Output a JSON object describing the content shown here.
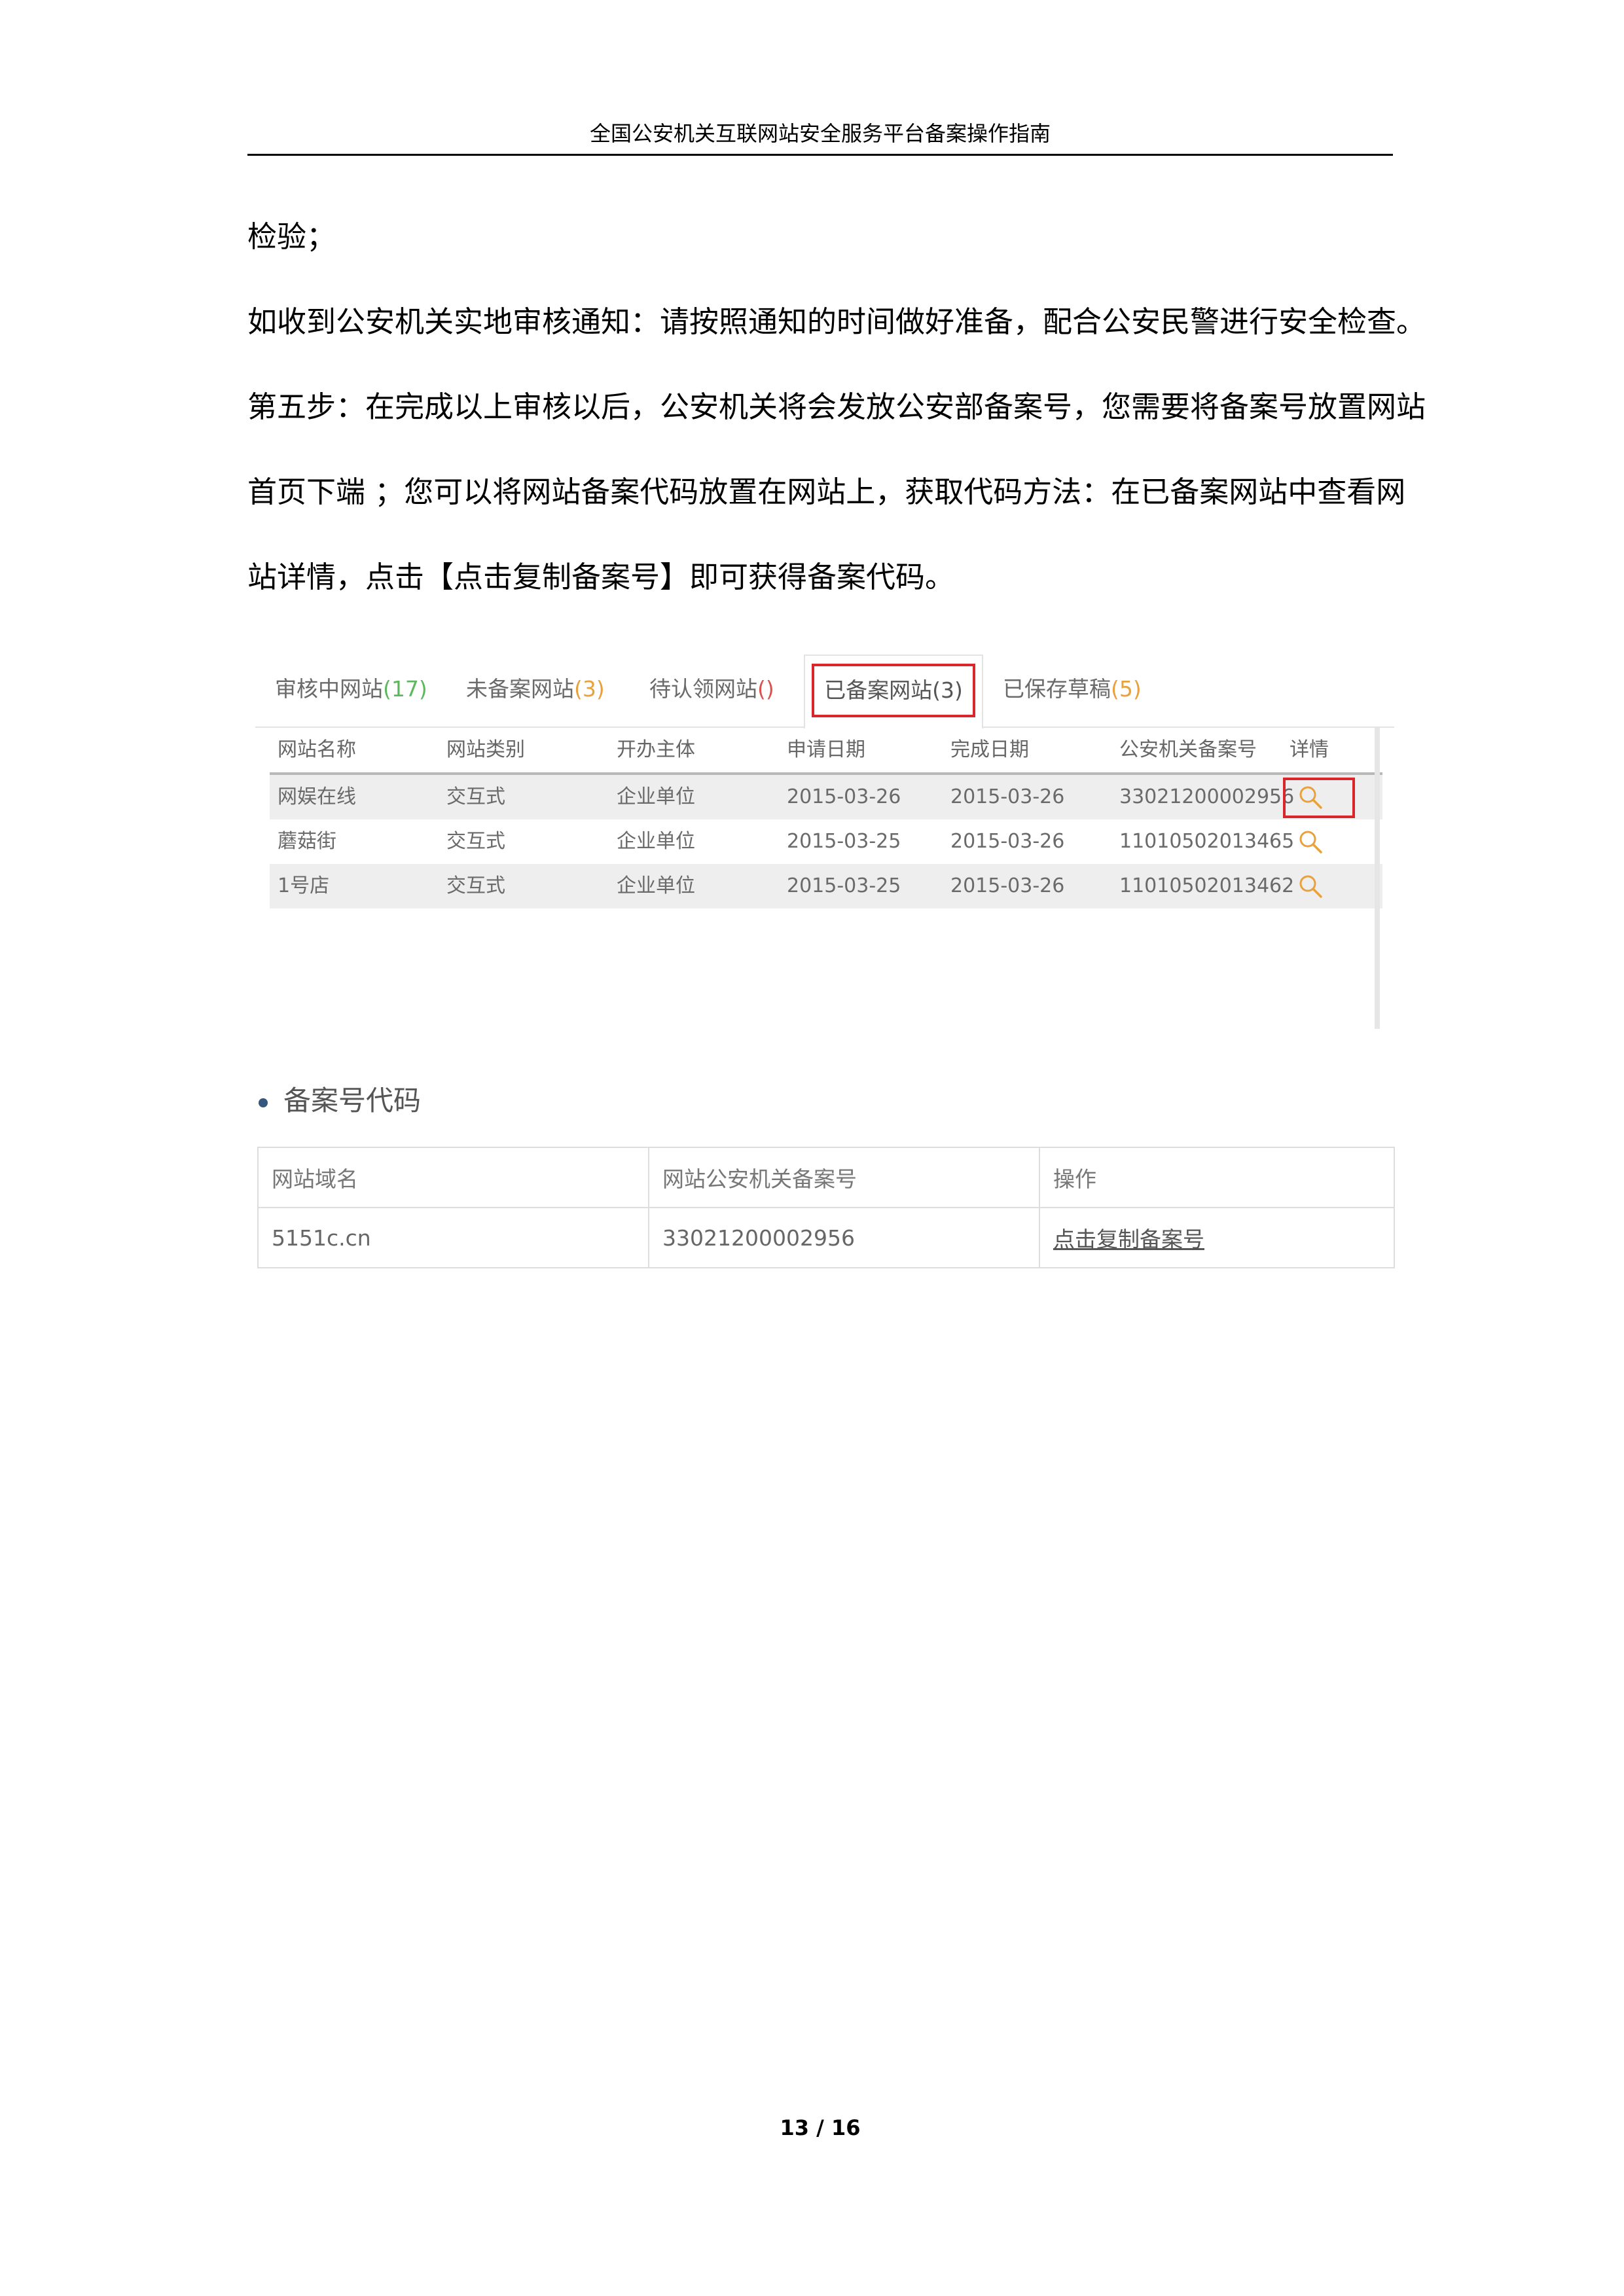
{
  "header": {
    "title": "全国公安机关互联网站安全服务平台备案操作指南"
  },
  "paragraphs": [
    "检验；",
    "如收到公安机关实地审核通知：请按照通知的时间做好准备，配合公安民警进行安全检查。",
    "第五步：在完成以上审核以后，公安机关将会发放公安部备案号，您需要将备案号放置网站",
    "首页下端 ；您可以将网站备案代码放置在网站上，获取代码方法：在已备案网站中查看网",
    "站详情，点击【点击复制备案号】即可获得备案代码。"
  ],
  "tabs": [
    {
      "label": "审核中网站",
      "count": "(17)",
      "count_color": "#5cb85c"
    },
    {
      "label": "未备案网站",
      "count": "(3)",
      "count_color": "#e8a13c"
    },
    {
      "label": "待认领网站",
      "count": "()",
      "count_color": "#d9534f"
    },
    {
      "label": "已备案网站(3)",
      "count": "",
      "active": true
    },
    {
      "label": "已保存草稿",
      "count": "(5)",
      "count_color": "#e8a13c"
    }
  ],
  "site_table": {
    "headers": [
      "网站名称",
      "网站类别",
      "开办主体",
      "申请日期",
      "完成日期",
      "公安机关备案号",
      "详情"
    ],
    "rows": [
      [
        "网娱在线",
        "交互式",
        "企业单位",
        "2015-03-26",
        "2015-03-26",
        "33021200002956"
      ],
      [
        "蘑菇街",
        "交互式",
        "企业单位",
        "2015-03-25",
        "2015-03-26",
        "11010502013465"
      ],
      [
        "1号店",
        "交互式",
        "企业单位",
        "2015-03-25",
        "2015-03-26",
        "11010502013462"
      ]
    ],
    "detail_icon": "search-icon"
  },
  "code_section": {
    "title": "备案号代码",
    "headers": [
      "网站域名",
      "网站公安机关备案号",
      "操作"
    ],
    "row": [
      "5151c.cn",
      "33021200002956",
      "点击复制备案号"
    ]
  },
  "footer": {
    "page": "13 / 16"
  },
  "colors": {
    "highlight": "#d9262b",
    "icon": "#e8a13c",
    "bullet": "#34577d"
  }
}
